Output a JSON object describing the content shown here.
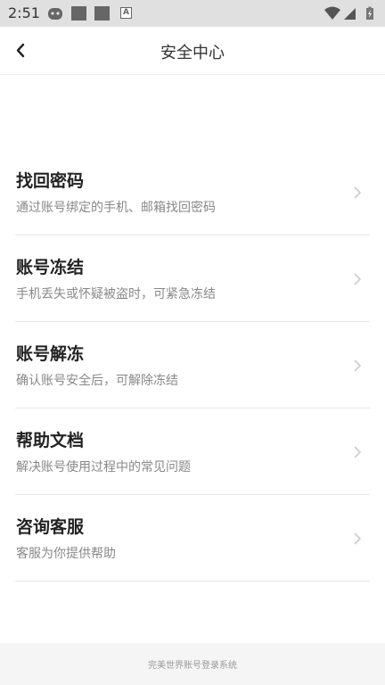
{
  "status_bar": {
    "time": "2:51",
    "icons": [
      "android-debug-icon",
      "notification-square-icon",
      "notification-square-icon",
      "keyboard-a-icon",
      "wifi-icon",
      "signal-icon",
      "battery-charging-icon"
    ]
  },
  "header": {
    "title": "安全中心",
    "back_icon": "back-arrow-icon"
  },
  "menu": {
    "items": [
      {
        "title": "找回密码",
        "desc": "通过账号绑定的手机、邮箱找回密码"
      },
      {
        "title": "账号冻结",
        "desc": "手机丢失或怀疑被盗时，可紧急冻结"
      },
      {
        "title": "账号解冻",
        "desc": "确认账号安全后，可解除冻结"
      },
      {
        "title": "帮助文档",
        "desc": "解决账号使用过程中的常见问题"
      },
      {
        "title": "咨询客服",
        "desc": "客服为你提供帮助"
      }
    ]
  },
  "footer": {
    "text": "完美世界账号登录系统"
  }
}
